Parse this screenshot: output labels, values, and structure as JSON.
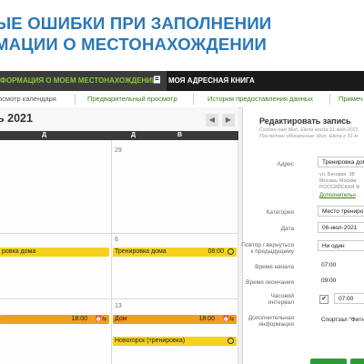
{
  "slide": {
    "title_line1": "ЫЕ ОШИБКИ ПРИ ЗАПОЛНЕНИИ",
    "title_line2": "МАЦИИ О МЕСТОНАХОЖДЕНИИ"
  },
  "topnav": {
    "tab_location": "ФОРМАЦИЯ О МОЕМ МЕСТОНАХОЖДЕНИИ",
    "tab_addressbook": "МОЯ АДРЕСНАЯ КНИГА"
  },
  "subtabs": [
    {
      "label": "осмотр календаря"
    },
    {
      "label": "Предварительный просмотр"
    },
    {
      "label": "История предоставления данных"
    },
    {
      "label": "Примеч"
    }
  ],
  "calendar": {
    "month": "ь 2021",
    "prev": "◀",
    "next": "▶",
    "weekdays": [
      "Д",
      "Д",
      "В"
    ],
    "day_29": "29",
    "day_6": "6",
    "day_13": "13",
    "events": {
      "ev1_label": "ровка дома",
      "ev2_label": "Тренировка дома",
      "ev2_time": "08:00",
      "ev3_time": "18:00",
      "ev4_label": "Дом",
      "ev4_time": "18:00",
      "ev5_label": "Новогорск (тренировка)"
    }
  },
  "panel": {
    "title": "Редактировать запись",
    "meta1": "Создан нам Mun, Elena когда 31-мая-2021",
    "meta2": "Последнее обновление: Mun, Elena к 31-м",
    "labels": {
      "address": "Адрес",
      "category": "Категория",
      "date": "Дата",
      "repeat": "Повтор / вернуться к предыдущему",
      "start": "Время начала",
      "end": "Время окончания",
      "hourly": "Часовой интервал",
      "extra": "Дополнительная информация"
    },
    "values": {
      "address": "Тренировка дом",
      "address_line1": "ул. Беговая, 38",
      "address_line2": "Москва, Москва",
      "address_line3": "РОССИЙСКАЯ Ф",
      "more_link": "Дополнительн",
      "category": "Место трениро",
      "date": "06-июл-2021",
      "repeat": "Ни один",
      "start": "07:00",
      "end": "09:00",
      "hourly_check": "✔",
      "hourly_time": "07:00",
      "extra": "Спортзал \"Фитн"
    }
  },
  "colors": {
    "title_blue": "#2a78b8",
    "nav_black": "#1b1b1b",
    "active_green": "#8cc63f",
    "event_yellow": "#f4d21c",
    "event_orange": "#f19d1f"
  }
}
